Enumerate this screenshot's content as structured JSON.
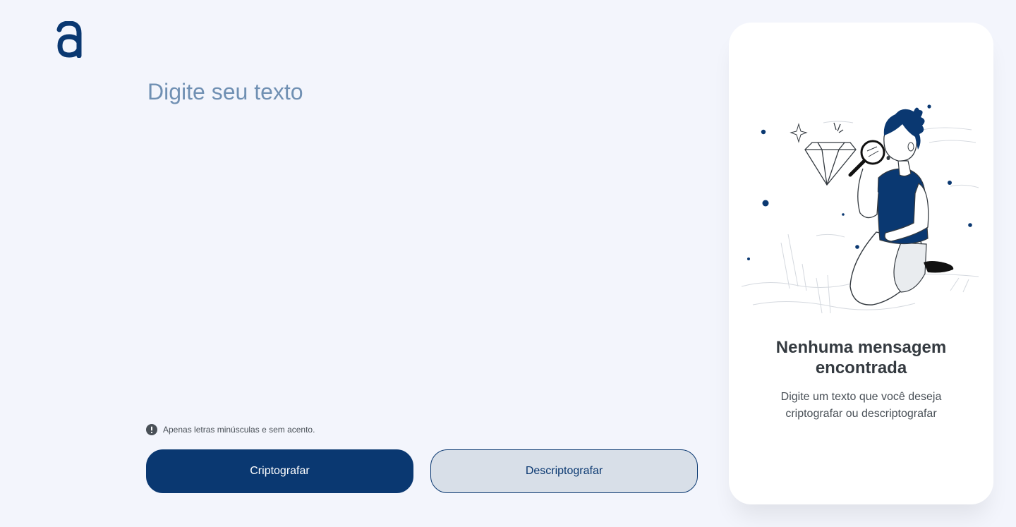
{
  "app": {
    "logo_icon": "alura-logo-icon",
    "accent_color": "#0a3871",
    "background_color": "#f3f5fc"
  },
  "editor": {
    "placeholder": "Digite seu texto",
    "value": ""
  },
  "hint": {
    "icon": "exclamation-circle-icon",
    "text": "Apenas letras minúsculas e sem acento."
  },
  "actions": {
    "encrypt_label": "Criptografar",
    "decrypt_label": "Descriptografar"
  },
  "output_panel": {
    "illustration": "boy-with-magnifying-glass-illustration",
    "title": "Nenhuma mensagem encontrada",
    "text": "Digite um texto que você deseja criptografar ou descriptografar"
  }
}
